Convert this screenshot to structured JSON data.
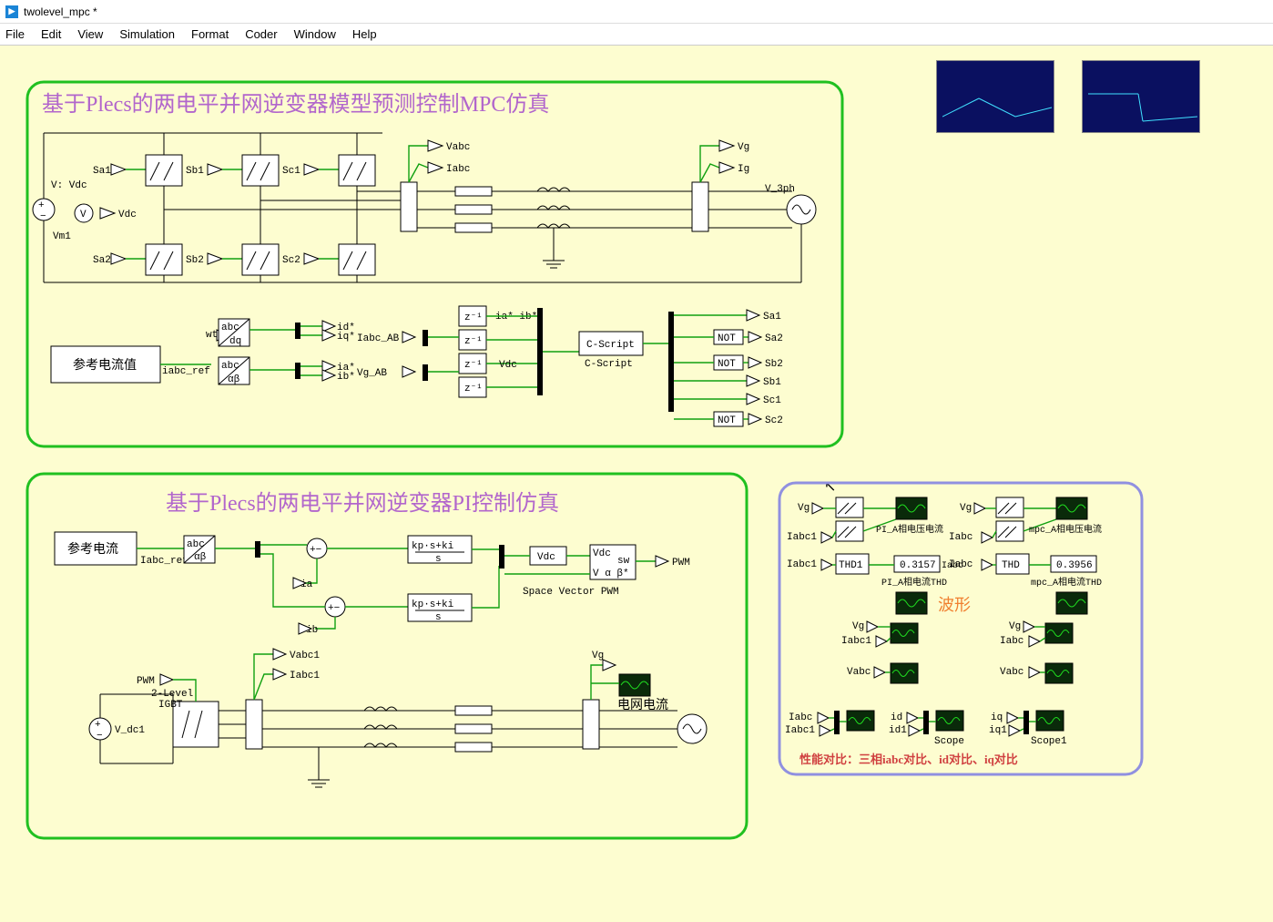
{
  "window": {
    "title": "twolevel_mpc *"
  },
  "menu": {
    "file": "File",
    "edit": "Edit",
    "view": "View",
    "simulation": "Simulation",
    "format": "Format",
    "coder": "Coder",
    "window": "Window",
    "help": "Help"
  },
  "mpc": {
    "title": "基于Plecs的两电平并网逆变器模型预测控制MPC仿真",
    "vdc": "V: Vdc",
    "vm1": "Vm1",
    "vdc_port": "Vdc",
    "sa1": "Sa1",
    "sb1": "Sb1",
    "sc1": "Sc1",
    "sa2": "Sa2",
    "sb2": "Sb2",
    "sc2": "Sc2",
    "vabc": "Vabc",
    "iabc": "Iabc",
    "vg": "Vg",
    "ig": "Ig",
    "v3ph": "V_3ph",
    "ref_block": "参考电流值",
    "iabc_ref": "iabc_ref",
    "wt": "wt",
    "abc_dq": "abc\n/dq",
    "abc_ab": "abc\n/α β",
    "id": "id*",
    "iq": "iq*",
    "ia": "ia*",
    "ib": "ib*",
    "iabc_AB": "Iabc_AB",
    "vg_AB": "Vg_AB",
    "z1": "z⁻¹",
    "ia_ib": "ia*\nib*",
    "vdc_lbl": "Vdc",
    "cscript": "C-Script",
    "cscript2": "C-Script",
    "not": "NOT",
    "osa1": "Sa1",
    "osa2": "Sa2",
    "osb2": "Sb2",
    "osb1": "Sb1",
    "osc1": "Sc1",
    "osc2": "Sc2"
  },
  "pi": {
    "title": "基于Plecs的两电平并网逆变器PI控制仿真",
    "ref": "参考电流",
    "iabc_ref": "Iabc_ref",
    "abc_ab": "abc\n/α β",
    "ia": "ia",
    "ib": "ib",
    "kp": "kp·s+ki\n   s",
    "vdc": "Vdc",
    "svpwm": "Space Vector PWM",
    "pwm": "PWM",
    "vdc_in": "Vdc",
    "sw": "sw",
    "vab": "V α β*",
    "vabc1": "Vabc1",
    "iabc1": "Iabc1",
    "pwm_in": "PWM",
    "vdc1": "V_dc1",
    "igbt": "2-Level\nIGBT",
    "vg": "Vg",
    "gridI": "电网电流"
  },
  "cmp": {
    "vg": "Vg",
    "iabc1": "Iabc1",
    "thd1": "THD1",
    "thd": "THD",
    "pi_scope": "PI_A相电压电流",
    "mpc_scope": "mpc_A相电压电流",
    "pi_thd_val": "0.3157",
    "pi_thd_lbl": "PI_A相电流THD",
    "iabc": "Iabc",
    "mpc_thd_val": "0.3956",
    "mpc_thd_lbl": "mpc_A相电流THD",
    "wave": "波形",
    "vabc": "Vabc",
    "iabc_bot": "Iabc",
    "iabc1_bot": "Iabc1",
    "id": "id",
    "id1": "id1",
    "iq": "iq",
    "iq1": "iq1",
    "scope": "Scope",
    "scope1": "Scope1",
    "footer": "性能对比：三相iabc对比、id对比、iq对比"
  }
}
